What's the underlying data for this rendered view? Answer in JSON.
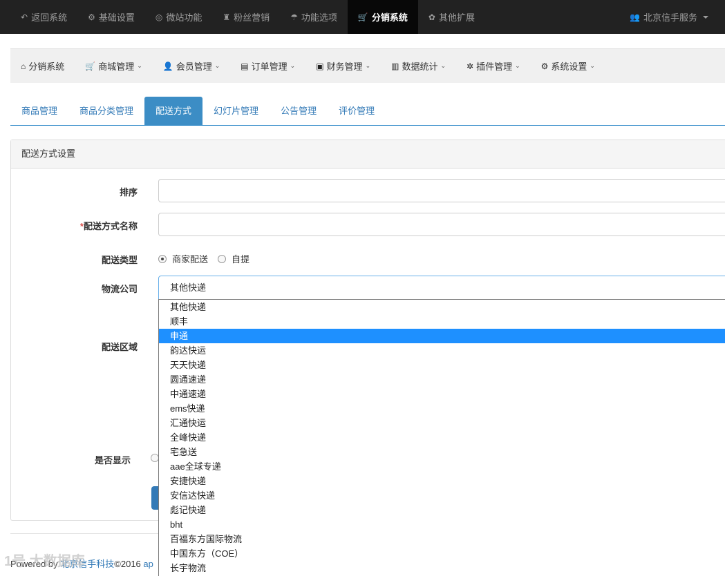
{
  "topnav": {
    "items": [
      {
        "icon": "↶",
        "label": "返回系统"
      },
      {
        "icon": "⚙",
        "label": "基础设置"
      },
      {
        "icon": "◎",
        "label": "微站功能"
      },
      {
        "icon": "♜",
        "label": "粉丝营销"
      },
      {
        "icon": "☂",
        "label": "功能选项"
      },
      {
        "icon": "🛒",
        "label": "分销系统"
      },
      {
        "icon": "✿",
        "label": "其他扩展"
      }
    ],
    "active_index": 5,
    "user": {
      "icon": "👥",
      "label": "北京信手服务"
    }
  },
  "menubar": {
    "items": [
      {
        "icon": "⌂",
        "label": "分销系统",
        "dropdown": false
      },
      {
        "icon": "🛒",
        "label": "商城管理",
        "dropdown": true
      },
      {
        "icon": "👤",
        "label": "会员管理",
        "dropdown": true
      },
      {
        "icon": "▤",
        "label": "订单管理",
        "dropdown": true
      },
      {
        "icon": "▣",
        "label": "财务管理",
        "dropdown": true
      },
      {
        "icon": "▥",
        "label": "数据统计",
        "dropdown": true
      },
      {
        "icon": "✲",
        "label": "插件管理",
        "dropdown": true
      },
      {
        "icon": "⚙",
        "label": "系统设置",
        "dropdown": true
      }
    ]
  },
  "tabs": [
    "商品管理",
    "商品分类管理",
    "配送方式",
    "幻灯片管理",
    "公告管理",
    "评价管理"
  ],
  "active_tab": 2,
  "panel": {
    "title": "配送方式设置"
  },
  "form": {
    "sort_label": "排序",
    "name_required_mark": "*",
    "name_label": "配送方式名称",
    "type_label": "配送类型",
    "type_options": [
      "商家配送",
      "自提"
    ],
    "type_selected": "商家配送",
    "logistics_label": "物流公司",
    "logistics_value": "其他快递",
    "area_label": "配送区域",
    "show_label": "是否显示"
  },
  "logistics_options": [
    "其他快递",
    "顺丰",
    "申通",
    "韵达快运",
    "天天快递",
    "圆通速递",
    "中通速递",
    "ems快递",
    "汇通快运",
    "全峰快递",
    "宅急送",
    "aae全球专递",
    "安捷快递",
    "安信达快递",
    "彪记快递",
    "bht",
    "百福东方国际物流",
    "中国东方（COE）",
    "长宇物流"
  ],
  "logistics_highlighted": "申通",
  "footer": {
    "prefix": "Powered by ",
    "company": "北京信手科技",
    "copyright": "©2016 ",
    "link_tail": "ap"
  },
  "watermark": "1号 大数据库"
}
